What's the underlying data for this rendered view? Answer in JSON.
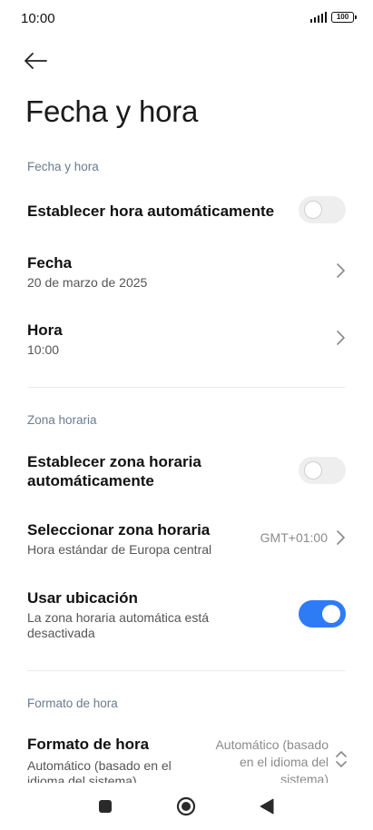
{
  "status_bar": {
    "time": "10:00",
    "battery": "100"
  },
  "header": {
    "title": "Fecha y hora"
  },
  "sections": {
    "date_time": {
      "header": "Fecha y hora",
      "auto_time": {
        "label": "Establecer hora automáticamente",
        "enabled": false
      },
      "date": {
        "label": "Fecha",
        "value": "20 de marzo de 2025"
      },
      "time": {
        "label": "Hora",
        "value": "10:00"
      }
    },
    "time_zone": {
      "header": "Zona horaria",
      "auto_zone": {
        "label_line1": "Establecer zona horaria",
        "label_line2": "automáticamente",
        "enabled": false
      },
      "select_zone": {
        "label": "Seleccionar zona horaria",
        "subtitle": "Hora estándar de Europa central",
        "value": "GMT+01:00"
      },
      "use_location": {
        "label": "Usar ubicación",
        "subtitle_line1": "La zona horaria automática está",
        "subtitle_line2": "desactivada",
        "enabled": true
      }
    },
    "time_format": {
      "header": "Formato de hora",
      "format": {
        "label": "Formato de hora",
        "subtitle_line1": "Automático (basado en el",
        "subtitle_line2": "idioma del sistema)",
        "value_line1": "Automático (basado",
        "value_line2": "en el idioma del",
        "value_line3": "sistema)"
      }
    }
  },
  "colors": {
    "accent": "#2e7bf6",
    "section_header": "#6b7b8f",
    "toggle_off": "#eeeeee"
  },
  "icons": {
    "back": "arrow-left-icon",
    "chevron": "chevron-right-icon",
    "updown": "chevron-up-down-icon",
    "nav_recents": "square-icon",
    "nav_home": "circle-icon",
    "nav_back": "triangle-left-icon"
  }
}
